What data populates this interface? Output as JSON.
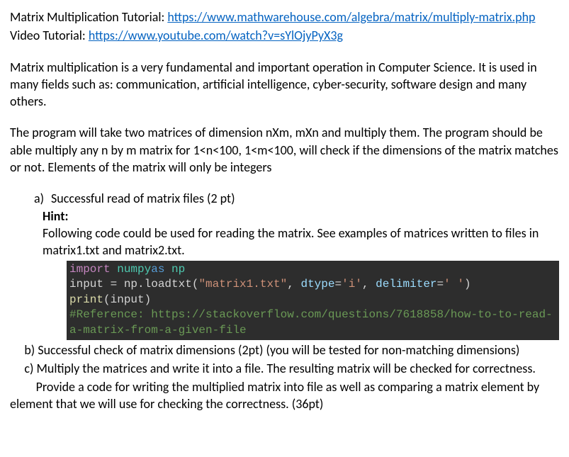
{
  "intro": {
    "tutorial_label": "Matrix Multiplication Tutorial: ",
    "tutorial_url": "https://www.mathwarehouse.com/algebra/matrix/multiply-matrix.php",
    "video_label": "Video Tutorial: ",
    "video_url": "https://www.youtube.com/watch?v=sYlOjyPyX3g"
  },
  "desc": {
    "p1": "Matrix multiplication is a very fundamental and important operation in Computer Science. It is used in many fields such as: communication, artificial intelligence, cyber-security, software design and many others.",
    "p2": "The program will take two matrices of dimension nXm, mXn and multiply them. The program should be able multiply any n by m matrix for 1<n<100, 1<m<100, will check if the dimensions of the matrix matches or not. Elements of the matrix will only be integers"
  },
  "a": {
    "marker": "a)",
    "title": "Successful read of matrix files (2 pt)",
    "hint_label": "Hint:",
    "hint_text": "Following code could be used for reading the matrix. See examples of matrices written to files in matrix1.txt and matrix2.txt."
  },
  "code": {
    "kw_import": "import",
    "sp": " ",
    "mod_numpy": "numpy",
    "kw_as": "as",
    "mod_np": "np",
    "line2_a": "input = np.loadtxt(",
    "str_file": "\"matrix1.txt\"",
    "line2_b": ", ",
    "arg_dtype": "dtype",
    "eq": "=",
    "str_i": "'i'",
    "line2_c": ", ",
    "arg_delim": "delimiter",
    "str_delim": "' '",
    "line2_d": ")",
    "fn_print": "print",
    "line3_b": "(input)",
    "comment": "#Reference: https://stackoverflow.com/questions/7618858/how-to-to-read-a-matrix-from-a-given-file"
  },
  "b": {
    "text": "     b) Successful check of matrix dimensions (2pt) (you will be tested for non-matching dimensions)"
  },
  "c": {
    "text": "     c) Multiply the matrices and write it into a file. The resulting matrix will be checked for correctness.",
    "text2": "         Provide a code for writing the multiplied matrix into file as well as comparing a matrix element by element that we will use for checking the correctness. (36pt)"
  }
}
